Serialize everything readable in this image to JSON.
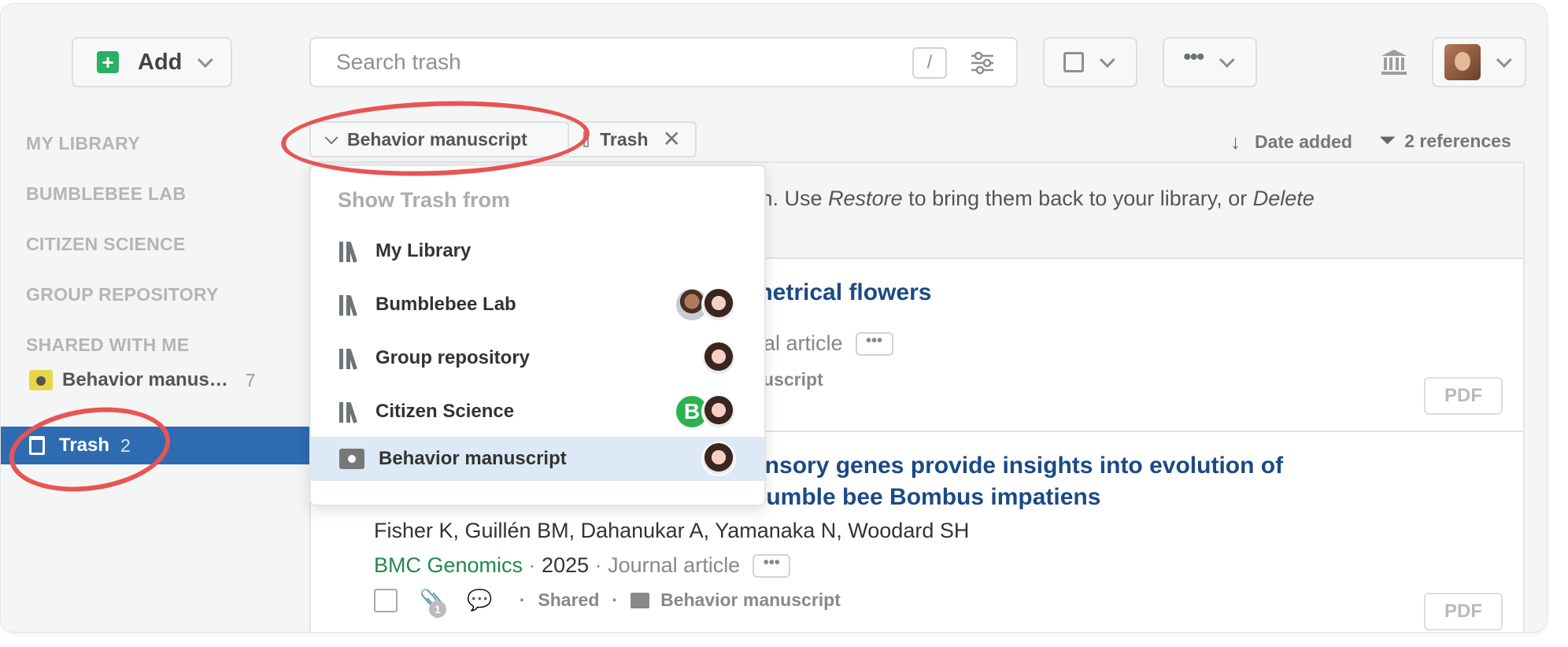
{
  "toolbar": {
    "add_label": "Add",
    "search_placeholder": "Search trash",
    "slash_key": "/"
  },
  "sidebar": {
    "headings": [
      "MY LIBRARY",
      "BUMBLEBEE LAB",
      "CITIZEN SCIENCE",
      "GROUP REPOSITORY",
      "SHARED WITH ME"
    ],
    "shared_folder": {
      "label": "Behavior manus…",
      "count": "7"
    },
    "trash": {
      "label": "Trash",
      "count": "2"
    }
  },
  "breadcrumb": {
    "folder": "Behavior manuscript",
    "trash": "Trash",
    "close": "✕"
  },
  "list_header": {
    "sort_label": "Date added",
    "refs_label": "2 references"
  },
  "info": {
    "pre": "sh. Use ",
    "restore": "Restore",
    "mid": " to bring them back to your library, or ",
    "delete": "Delete"
  },
  "items": [
    {
      "title_visible": "metrical flowers",
      "meta_visible": "nal article",
      "folder_visible": "nuscript",
      "pdf": "PDF"
    },
    {
      "title_line1_visible": "ensory genes provide insights into evolution of",
      "title_line2_visible": "bumble bee Bombus impatiens",
      "authors": "Fisher K, Guillén BM, Dahanukar A, Yamanaka N, Woodard SH",
      "journal": "BMC Genomics",
      "year": "2025",
      "type": "Journal article",
      "attachment_count": "1",
      "shared": "Shared",
      "folder": "Behavior manuscript",
      "pdf": "PDF"
    }
  ],
  "dropdown": {
    "heading": "Show Trash from",
    "options": [
      {
        "label": "My Library",
        "icon": "library-icon",
        "avatars": []
      },
      {
        "label": "Bumblebee Lab",
        "icon": "library-icon",
        "avatars": [
          "man",
          "woman"
        ]
      },
      {
        "label": "Group repository",
        "icon": "library-icon",
        "avatars": [
          "woman"
        ]
      },
      {
        "label": "Citizen Science",
        "icon": "library-icon",
        "avatars": [
          "B",
          "woman"
        ]
      },
      {
        "label": "Behavior manuscript",
        "icon": "shared-folder-icon",
        "avatars": [
          "woman"
        ],
        "selected": true
      }
    ]
  },
  "colors": {
    "accent_blue": "#2e6bb0",
    "title_blue": "#1b4a86",
    "journal_green": "#1f8a4c",
    "highlight_red": "#e85454"
  }
}
